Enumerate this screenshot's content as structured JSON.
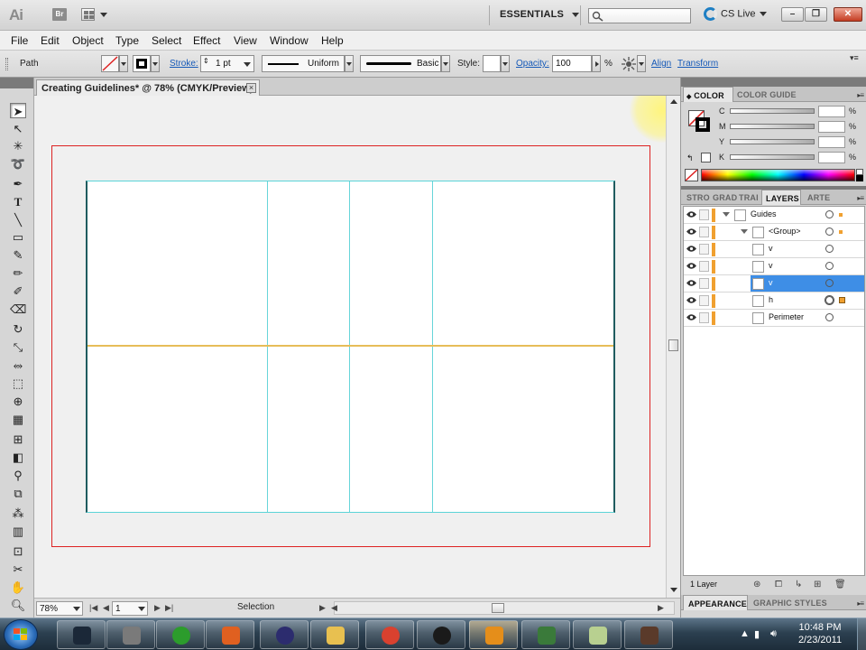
{
  "titlebar": {
    "app_logo": "Ai",
    "bridge_label": "Br",
    "workspace": "ESSENTIALS",
    "search_placeholder": "",
    "cslive": "CS Live"
  },
  "menu": [
    "File",
    "Edit",
    "Object",
    "Type",
    "Select",
    "Effect",
    "View",
    "Window",
    "Help"
  ],
  "controlbar": {
    "object_type": "Path",
    "stroke_label": "Stroke:",
    "stroke_value": "1 pt",
    "profile": "Uniform",
    "brush": "Basic",
    "style_label": "Style:",
    "opacity_label": "Opacity:",
    "opacity_value": "100",
    "percent": "%",
    "align_link": "Align",
    "transform_link": "Transform"
  },
  "document": {
    "tab_title": "Creating Guidelines* @ 78% (CMYK/Preview)",
    "close_glyph": "×",
    "bleed_color": "#d22222",
    "guide_color": "#67d5d9",
    "horizontal_guide_color": "#e7bd58"
  },
  "statusbar": {
    "zoom": "78%",
    "artboard_number": "1",
    "current_tool": "Selection"
  },
  "color_panel": {
    "tabs": [
      "COLOR",
      "COLOR GUIDE"
    ],
    "channels": [
      {
        "label": "C",
        "unit": "%"
      },
      {
        "label": "M",
        "unit": "%"
      },
      {
        "label": "Y",
        "unit": "%"
      },
      {
        "label": "K",
        "unit": "%"
      }
    ]
  },
  "layers_panel": {
    "tabs": [
      "STRO",
      "GRAD",
      "TRAI",
      "LAYERS",
      "ARTE"
    ],
    "rows": [
      {
        "name": "Guides",
        "indent": 0,
        "expandable": true,
        "selected": false,
        "has_sel": true
      },
      {
        "name": "<Group>",
        "indent": 1,
        "expandable": true,
        "selected": false,
        "has_sel": true
      },
      {
        "name": "v",
        "indent": 2,
        "expandable": false,
        "selected": false,
        "has_sel": false
      },
      {
        "name": "v",
        "indent": 2,
        "expandable": false,
        "selected": false,
        "has_sel": false
      },
      {
        "name": "v",
        "indent": 2,
        "expandable": false,
        "selected": true,
        "has_sel": false
      },
      {
        "name": "h",
        "indent": 2,
        "expandable": false,
        "selected": false,
        "has_sel": true
      },
      {
        "name": "Perimeter",
        "indent": 2,
        "expandable": false,
        "selected": false,
        "has_sel": false
      }
    ],
    "layer_count": "1 Layer"
  },
  "bottom_tabs": [
    "APPEARANCE",
    "GRAPHIC STYLES"
  ],
  "taskbar": {
    "time": "10:48 PM",
    "date": "2/23/2011",
    "apps": [
      {
        "name": "steam",
        "color": "#1b2838"
      },
      {
        "name": "home",
        "color": "#7a7a7a"
      },
      {
        "name": "utorrent",
        "color": "#2c9c2c"
      },
      {
        "name": "media",
        "color": "#e06020"
      },
      {
        "name": "eclipse",
        "color": "#2c2c6e"
      },
      {
        "name": "explorer",
        "color": "#e8c050"
      },
      {
        "name": "chrome",
        "color": "#d9412f"
      },
      {
        "name": "hp",
        "color": "#1a1a1a"
      },
      {
        "name": "illustrator",
        "color": "#e58e1a"
      },
      {
        "name": "network",
        "color": "#3a7a3a"
      },
      {
        "name": "notes",
        "color": "#b8d090"
      },
      {
        "name": "camera",
        "color": "#5a3a2a"
      }
    ]
  }
}
